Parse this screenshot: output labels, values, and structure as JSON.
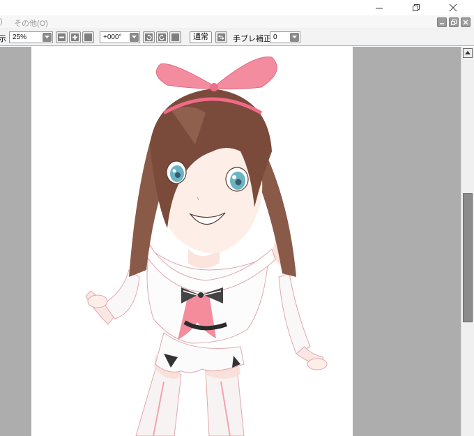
{
  "window": {
    "minimize_icon": "minimize-icon",
    "restore_icon": "restore-icon",
    "close_icon": "close-icon"
  },
  "menubar": {
    "partial_left": ")",
    "other_menu": "その他(O)"
  },
  "toolbar": {
    "zoom_label_partial": "示",
    "zoom_value": "25%",
    "angle_value": "+000°",
    "mode_button": "通常",
    "stabilizer_label": "手ブレ補正",
    "stabilizer_value": "0"
  },
  "canvas": {
    "artwork": "anime-girl-illustration",
    "colors": {
      "background": "#adadad",
      "paper": "#ffffff",
      "accent": "#e8a86a",
      "bow": "#f08ca0",
      "hair": "#7a4a3a",
      "eyes": "#6ab4c4"
    }
  }
}
